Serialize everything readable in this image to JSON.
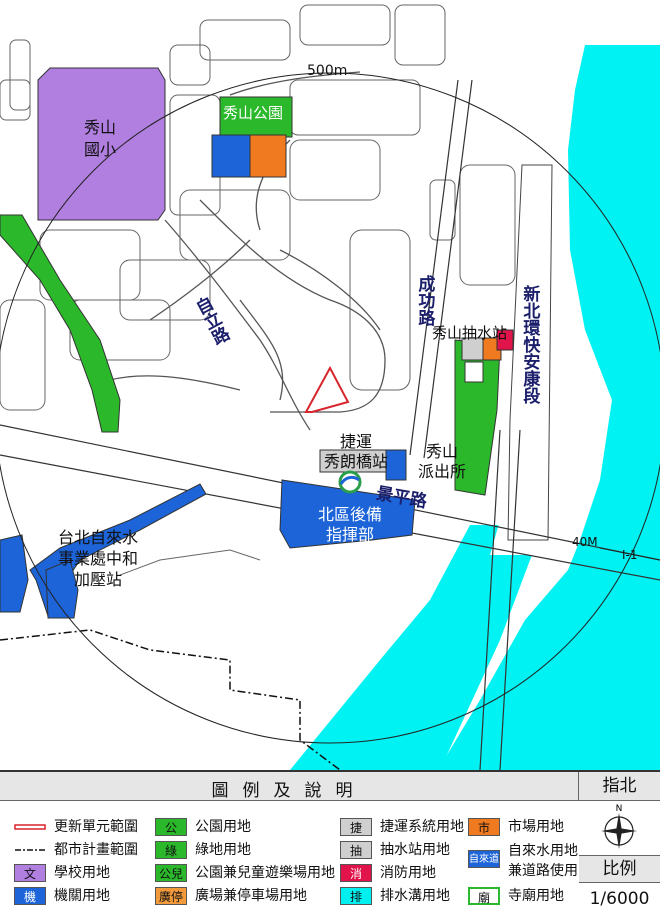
{
  "map": {
    "distance_label": "500m",
    "road_width_label": "40M",
    "road_code_label": "I-1",
    "labels": {
      "school": [
        "秀山",
        "國小"
      ],
      "park": "秀山公園",
      "ziqiang_road": "自立路",
      "chenggong_road": "成功路",
      "pump_station": "秀山抽水站",
      "expressway": "新北環快安康段",
      "mrt_station": [
        "捷運",
        "秀朗橋站"
      ],
      "police": [
        "秀山",
        "派出所"
      ],
      "jingping_road": "景平路",
      "command": [
        "北區後備",
        "指揮部"
      ],
      "water_company": [
        "台北自來水",
        "事業處中和",
        "加壓站"
      ]
    }
  },
  "legend": {
    "title": "圖例及說明",
    "north_title": "指北",
    "north_letter": "N",
    "scale_title": "比例",
    "scale_value": "1/6000",
    "items": [
      {
        "swatch": "",
        "label": "更新單元範圍",
        "color": "#d8242b",
        "kind": "redline"
      },
      {
        "swatch": "",
        "label": "都市計畫範圍",
        "color": "#111111",
        "kind": "dashline"
      },
      {
        "swatch": "文",
        "label": "學校用地",
        "color": "#b07fe0",
        "kind": "box"
      },
      {
        "swatch": "機",
        "label": "機關用地",
        "color": "#1c64d8",
        "kind": "box"
      },
      {
        "swatch": "公",
        "label": "公園用地",
        "color": "#2bb82b",
        "kind": "box"
      },
      {
        "swatch": "綠",
        "label": "綠地用地",
        "color": "#2bb82b",
        "kind": "box"
      },
      {
        "swatch": "公兒",
        "label": "公園兼兒童遊樂場用地",
        "color": "#2bb82b",
        "kind": "box"
      },
      {
        "swatch": "廣停",
        "label": "廣場兼停車場用地",
        "color": "#f39b3c",
        "kind": "box"
      },
      {
        "swatch": "捷",
        "label": "捷運系統用地",
        "color": "#cfcfcf",
        "kind": "box"
      },
      {
        "swatch": "抽",
        "label": "抽水站用地",
        "color": "#cfcfcf",
        "kind": "box"
      },
      {
        "swatch": "消",
        "label": "消防用地",
        "color": "#e0134a",
        "kind": "box"
      },
      {
        "swatch": "排",
        "label": "排水溝用地",
        "color": "#00f0f0",
        "kind": "box"
      },
      {
        "swatch": "市",
        "label": "市場用地",
        "color": "#f07a20",
        "kind": "box"
      },
      {
        "swatch": "自來道",
        "label": "自來水用地",
        "label2": "兼道路使用",
        "color": "#1c64d8",
        "kind": "box"
      },
      {
        "swatch": "廟",
        "label": "寺廟用地",
        "color": "#ffffff",
        "kind": "temple"
      }
    ]
  },
  "colors": {
    "river": "#00f2f2",
    "school": "#b07fe0",
    "green": "#2bb82b",
    "blue": "#1c64d8",
    "orange": "#f07a20",
    "redline": "#d8242b"
  }
}
